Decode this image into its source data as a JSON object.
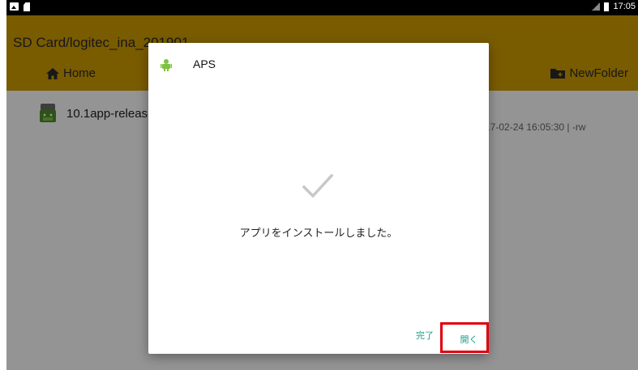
{
  "status_bar": {
    "time": "17:05",
    "icons": [
      "image-notification-icon",
      "sd-card-icon",
      "no-signal-icon",
      "battery-icon"
    ]
  },
  "app_bar": {
    "path": "SD Card/logitec_ina_201901",
    "home_label": "Home",
    "new_folder_label": "NewFolder",
    "accent_color": "#d19d00"
  },
  "file_list": [
    {
      "name": "10.1app-releas",
      "meta": "17-02-24 16:05:30 | -rw",
      "icon": "android-apk-icon"
    }
  ],
  "dialog": {
    "app_name": "APS",
    "app_icon": "android-icon",
    "status_icon": "checkmark-icon",
    "message": "アプリをインストールしました。",
    "done_label": "完了",
    "open_label": "開く",
    "button_color": "#1a9e86",
    "highlight_color": "#e0000b"
  }
}
